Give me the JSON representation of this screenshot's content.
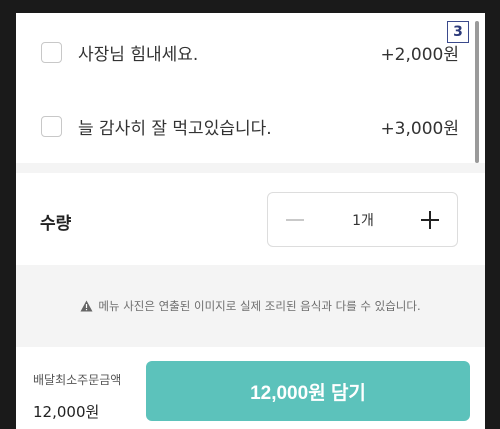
{
  "options": [
    {
      "label": "사장님 힘내세요.",
      "price": "+2,000원"
    },
    {
      "label": "늘 감사히 잘 먹고있습니다.",
      "price": "+3,000원"
    }
  ],
  "badge": "3",
  "quantity": {
    "label": "수량",
    "count": "1개",
    "minus_icon": "minus-icon",
    "plus_icon": "plus-icon"
  },
  "notice": {
    "icon": "warning-icon",
    "text": "메뉴 사진은 연출된 이미지로 실제 조리된 음식과 다를 수 있습니다."
  },
  "footer": {
    "min_order_label": "배달최소주문금액",
    "min_order_value": "12,000원",
    "cta_label": "12,000원 담기",
    "cta_color": "#5cc2bb"
  }
}
